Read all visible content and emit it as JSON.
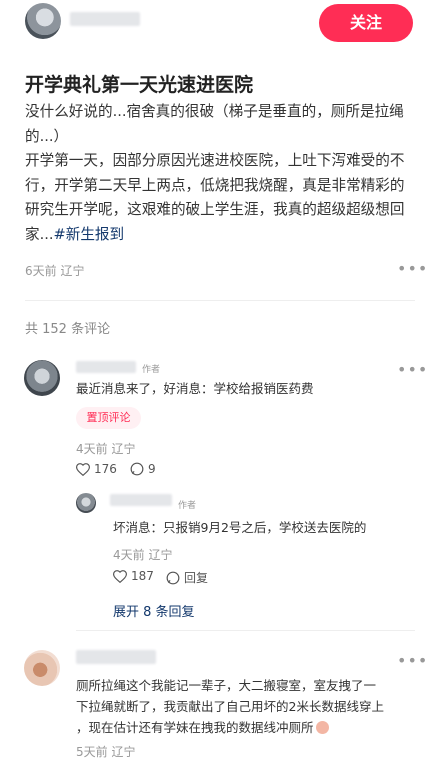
{
  "header": {
    "follow_label": "关注"
  },
  "post": {
    "title": "开学典礼第一天光速进医院",
    "body_line1": "没什么好说的...宿舍真的很破（梯子是垂直的，厕所是拉绳的...）",
    "body_line2": "开学第一天，因部分原因光速进校医院，上吐下泻难受的不行，开学第二天早上两点，低烧把我烧醒，真是非常精彩的研究生开学呢，这艰难的破上学生涯，我真的超级超级想回家...",
    "tag": "#新生报到",
    "meta": "6天前 辽宁"
  },
  "comments_header": {
    "count_text": "共 152 条评论"
  },
  "comments": [
    {
      "author_badge": "作者",
      "text": "最近消息来了，好消息：学校给报销医药费",
      "pin_label": "置顶评论",
      "meta": "4天前 辽宁",
      "likes": "176",
      "replies_count": "9",
      "reply": {
        "author_badge": "作者",
        "text": "坏消息：只报销9月2号之后，学校送去医院的",
        "meta": "4天前 辽宁",
        "likes": "187",
        "reply_label": "回复"
      },
      "expand_label": "展开 8 条回复"
    },
    {
      "text_line1": "厕所拉绳这个我能记一辈子，大二搬寝室，室友拽了一",
      "text_line2": "下拉绳就断了，我贡献出了自己用坏的2米长数据线穿上",
      "text_line3": "，现在估计还有学妹在拽我的数据线冲厕所",
      "meta": "5天前 辽宁"
    }
  ]
}
